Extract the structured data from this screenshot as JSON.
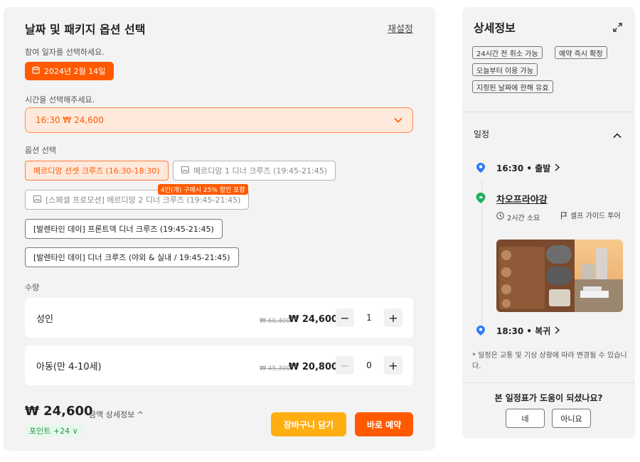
{
  "left": {
    "title": "날짜 및 패키지 옵션 선택",
    "reset": "재설정",
    "date_label": "참여 일자를 선택하세요.",
    "date_value": "2024년 2월 14일",
    "time_label": "시간을 선택해주세요.",
    "time_value": "16:30 ₩ 24,600",
    "option_label": "옵션 선택",
    "options": [
      {
        "label": "메르디앙 선셋 크루즈 (16:30-18:30)",
        "state": "selected"
      },
      {
        "label": "메르디앙 1 디너 크루즈 (19:45-21:45)",
        "state": "disabled"
      },
      {
        "label": "[스페셜 프로모션] 메르디앙 2 디너 크루즈 (19:45-21:45)",
        "state": "disabled"
      },
      {
        "label": "[발렌타인 데이] 프론트덱 디너 크루즈 (19:45-21:45)",
        "state": "normal"
      },
      {
        "label": "[발렌타인 데이] 디너 크루즈 (야외 & 실내 / 19:45-21:45)",
        "state": "normal"
      }
    ],
    "promo_badge": "4인(개) 구매시 25% 할인 포함",
    "qty_label": "수량",
    "quantities": [
      {
        "label": "성인",
        "orig": "₩ 60,400",
        "price": "₩ 24,600",
        "count": "1",
        "minus_disabled": false
      },
      {
        "label": "아동(만 4-10세)",
        "orig": "₩ 45,300",
        "price": "₩ 20,800",
        "count": "0",
        "minus_disabled": true
      }
    ],
    "total": "₩ 24,600",
    "detail_link": "금액 상세정보 ^",
    "points": "포인트 +24 ∨",
    "cart_button": "장바구니 담기",
    "book_button": "바로 예약"
  },
  "right": {
    "title": "상세정보",
    "tags": [
      "24시간 전 취소 가능",
      "예약 즉시 확정",
      "오늘부터 이용 가능",
      "지정된 날짜에 한해 유효"
    ],
    "schedule_label": "일정",
    "departure": "16:30 • 출발",
    "place": "차오프라야강",
    "duration": "2시간 소요",
    "guide": "셀프 가이드 투어",
    "return": "18:30 • 복귀",
    "note": "* 일정은 교통 및 기상 상황에 따라 변경될 수 있습니다.",
    "help_question": "본 일정표가 도움이 되셨나요?",
    "yes": "네",
    "no": "아니요"
  },
  "colors": {
    "accent": "#ff5a00",
    "accent_light": "#ffe9dc",
    "cart": "#ffae12",
    "points_green": "#1f9b4a",
    "pin_blue": "#2f7bf5"
  }
}
